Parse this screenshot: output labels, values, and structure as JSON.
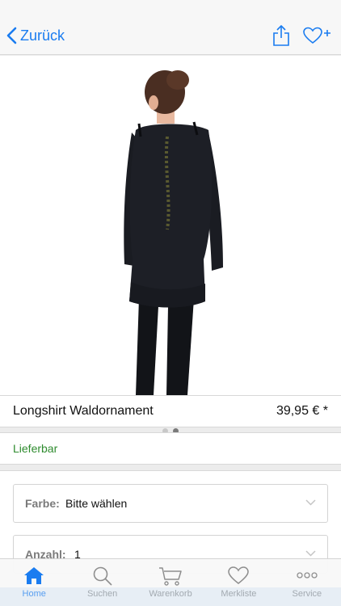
{
  "nav": {
    "back_label": "Zurück",
    "share_icon": "share-icon",
    "favorite_icon": "heart-plus-icon",
    "accent": "#1a7cf0"
  },
  "gallery": {
    "image_desc_icon": "product-photo",
    "page_count": 2,
    "active_page": 2
  },
  "product": {
    "title": "Longshirt Waldornament",
    "price": "39,95 € *"
  },
  "availability": {
    "text": "Lieferbar",
    "color": "#2e8b2e"
  },
  "options": {
    "color": {
      "label": "Farbe:",
      "value": "Bitte wählen"
    },
    "quantity": {
      "label": "Anzahl:",
      "value": "1"
    }
  },
  "tabbar": {
    "items": [
      {
        "label": "Home",
        "icon": "home-icon",
        "active": true
      },
      {
        "label": "Suchen",
        "icon": "search-icon",
        "active": false
      },
      {
        "label": "Warenkorb",
        "icon": "cart-icon",
        "active": false
      },
      {
        "label": "Merkliste",
        "icon": "heart-icon",
        "active": false
      },
      {
        "label": "Service",
        "icon": "more-icon",
        "active": false
      }
    ]
  }
}
